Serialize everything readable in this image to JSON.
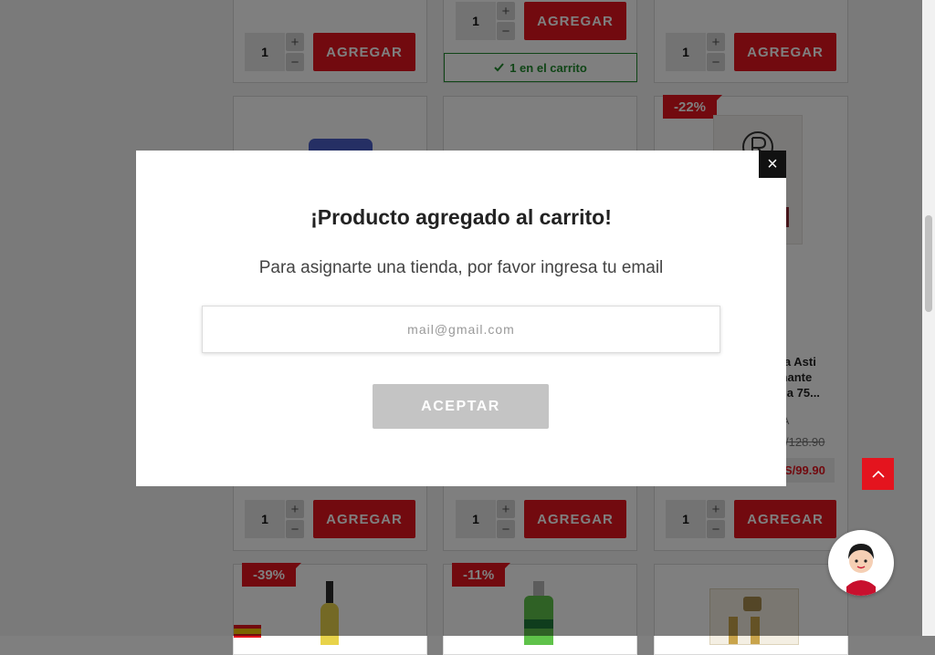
{
  "products": {
    "row1": [
      {
        "qty": "1",
        "add_label": "AGREGAR"
      },
      {
        "qty": "1",
        "add_label": "AGREGAR",
        "in_cart": "1 en el carrito"
      },
      {
        "qty": "1",
        "add_label": "AGREGAR"
      }
    ],
    "row2": [
      {
        "qty": "1",
        "add_label": "AGREGAR"
      },
      {
        "qty": "1",
        "add_label": "AGREGAR"
      },
      {
        "qty": "1",
        "add_label": "AGREGAR",
        "badge": "-22%",
        "name_lines": [
          "nna Asti",
          "umante",
          "tella 75..."
        ],
        "name_suffix": "A",
        "old_price": "/128.90",
        "new_price": "S/99.90"
      }
    ],
    "row3": [
      {
        "badge": "-39%"
      },
      {
        "badge": "-11%"
      },
      {}
    ]
  },
  "stepper": {
    "plus": "+",
    "minus": "−"
  },
  "modal": {
    "title": "¡Producto agregado al carrito!",
    "subtitle": "Para asignarte una tienda, por favor ingresa tu email",
    "email_placeholder": "mail@gmail.com",
    "accept_label": "ACEPTAR",
    "close_symbol": "×"
  },
  "colors": {
    "accent": "#e4141e",
    "in_cart": "#1f8a2d",
    "overlay": "rgba(0,0,0,0.5)"
  }
}
